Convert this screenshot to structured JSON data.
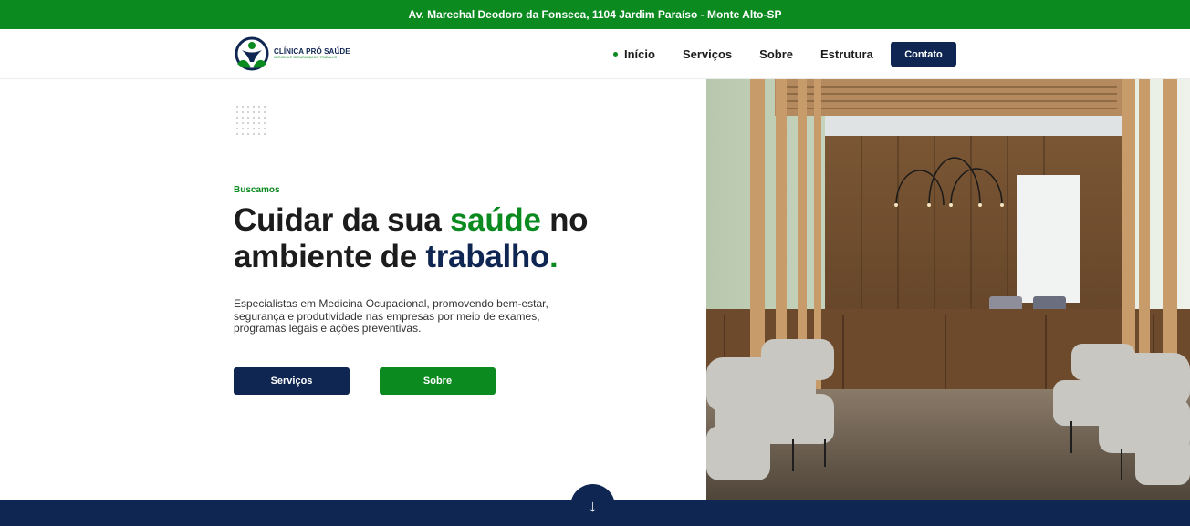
{
  "topbar": {
    "address": "Av. Marechal Deodoro da Fonseca, 1104 Jardim Paraíso - Monte Alto-SP"
  },
  "brand": {
    "name": "CLÍNICA PRÓ SAÚDE",
    "tagline": "MEDICINA E SEGURANÇA DO TRABALHO",
    "colors": {
      "green": "#0b8a20",
      "navy": "#0f2652"
    }
  },
  "nav": {
    "items": [
      {
        "label": "Início",
        "active": true
      },
      {
        "label": "Serviços"
      },
      {
        "label": "Sobre"
      },
      {
        "label": "Estrutura"
      }
    ],
    "contact_label": "Contato"
  },
  "hero": {
    "kicker": "Buscamos",
    "headline": {
      "part1": "Cuidar da sua ",
      "highlight1": "saúde",
      "part2": " no ambiente de ",
      "highlight2": "trabalho",
      "end": "."
    },
    "description": "Especialistas em Medicina Ocupacional, promovendo bem-estar, segurança e produtividade nas empresas por meio de exames, programas legais e ações preventivas.",
    "btn_services": "Serviços",
    "btn_about": "Sobre",
    "scroll_icon": "arrow-down-icon"
  }
}
